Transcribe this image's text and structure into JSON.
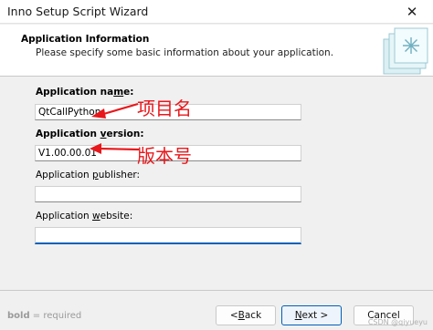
{
  "window": {
    "title": "Inno Setup Script Wizard",
    "close_glyph": "✕"
  },
  "header": {
    "title": "Application Information",
    "subtitle": "Please specify some basic information about your application.",
    "image_icon": "wizard-install-icon"
  },
  "form": {
    "name": {
      "label_pre": "Application na",
      "label_u": "m",
      "label_post": "e:",
      "value": "QtCallPython"
    },
    "version": {
      "label_pre": "Application ",
      "label_u": "v",
      "label_post": "ersion:",
      "value": "V1.00.00.01"
    },
    "publisher": {
      "label_pre": "Application ",
      "label_u": "p",
      "label_post": "ublisher:",
      "value": ""
    },
    "website": {
      "label_pre": "Application ",
      "label_u": "w",
      "label_post": "ebsite:",
      "value": ""
    }
  },
  "annotations": {
    "name_note": "项目名",
    "version_note": "版本号",
    "color": "#e8171b"
  },
  "footer": {
    "note_bold": "bold",
    "note_rest": " = required",
    "back_label_u": "B",
    "back_label_pre": "< ",
    "back_label_post": "ack",
    "next_label_u": "N",
    "next_label_post": "ext >",
    "cancel_label": "Cancel"
  },
  "watermark": "CSDN @qiyueyu"
}
